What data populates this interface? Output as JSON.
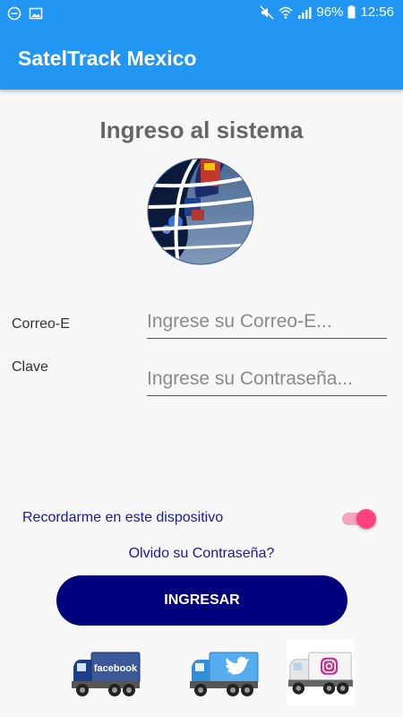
{
  "status_bar": {
    "icons_left": [
      "minus-circle-icon",
      "image-icon"
    ],
    "icons_right": [
      "mute-icon",
      "wifi-icon",
      "signal-icon"
    ],
    "battery": "96%",
    "time": "12:56"
  },
  "app_bar": {
    "title": "SatelTrack Mexico"
  },
  "login": {
    "title": "Ingreso al sistema",
    "email_label": "Correo-E",
    "email_placeholder": "Ingrese su Correo-E...",
    "email_value": "",
    "password_label": "Clave",
    "password_placeholder": "Ingrese su Contraseña...",
    "password_value": "",
    "remember_label": "Recordarme en este dispositivo",
    "remember_on": true,
    "forgot_label": "Olvido su Contraseña?",
    "submit_label": "INGRESAR"
  },
  "social": [
    {
      "name": "facebook",
      "label": "facebook",
      "color": "#3b5998"
    },
    {
      "name": "twitter",
      "label": "",
      "color": "#55acee"
    },
    {
      "name": "instagram",
      "label": "",
      "color": "#c13584"
    }
  ],
  "colors": {
    "primary": "#2196f3",
    "button": "#00007c",
    "link": "#1a1a99",
    "accent": "#ff4081"
  }
}
